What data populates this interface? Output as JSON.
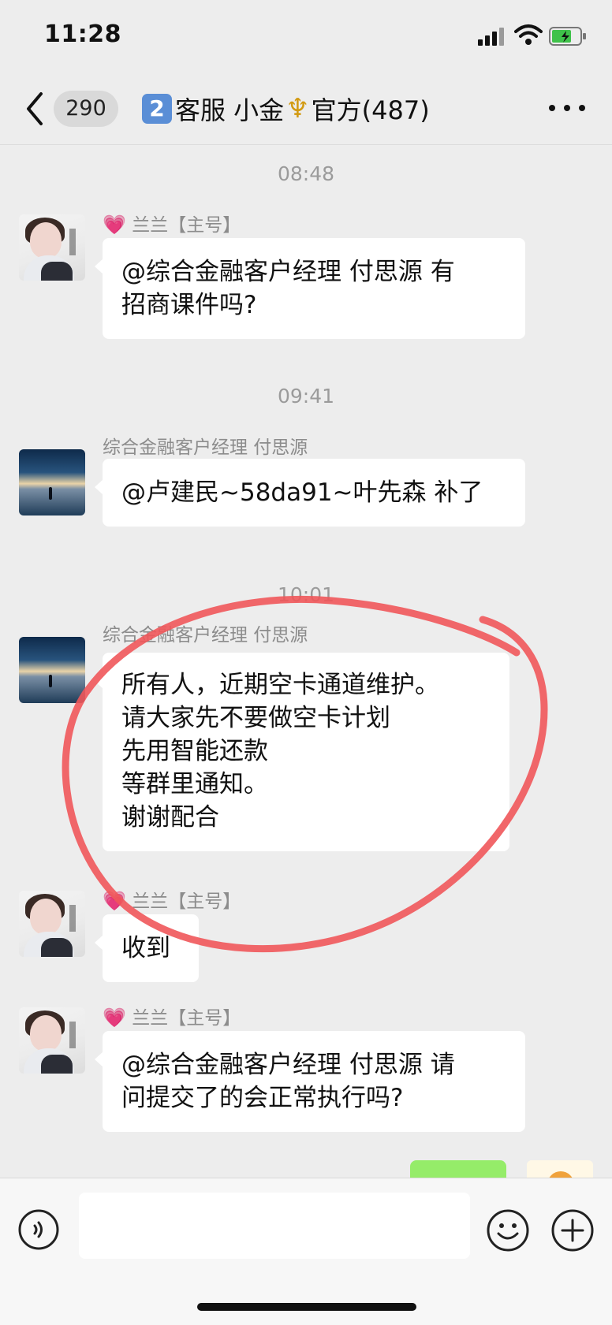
{
  "status_bar": {
    "time": "11:28"
  },
  "header": {
    "unread_count": "290",
    "group_number": "2",
    "title_prefix": "客服 小金",
    "title_suffix": "官方(487)"
  },
  "messages": [
    {
      "type": "time",
      "text": "08:48"
    },
    {
      "type": "text",
      "sender": "兰兰【主号】",
      "lines": [
        "@综合金融客户经理  付思源 有",
        "招商课件吗?"
      ]
    },
    {
      "type": "time",
      "text": "09:41"
    },
    {
      "type": "text",
      "sender": "综合金融客户经理  付思源",
      "lines": [
        "@卢建民~58da91~叶先森 补了"
      ]
    },
    {
      "type": "time",
      "text": "10:01"
    },
    {
      "type": "text",
      "sender": "综合金融客户经理  付思源",
      "lines": [
        "所有人，近期空卡通道维护。",
        "请大家先不要做空卡计划",
        "先用智能还款",
        "等群里通知。",
        "谢谢配合"
      ]
    },
    {
      "type": "text",
      "sender": "兰兰【主号】",
      "lines": [
        "收到"
      ]
    },
    {
      "type": "text",
      "sender": "兰兰【主号】",
      "lines": [
        "@综合金融客户经理  付思源 请",
        "问提交了的会正常执行吗?"
      ]
    }
  ],
  "icons": {
    "back": "chevron-left-icon",
    "more": "more-dots-icon",
    "voice": "voice-icon",
    "emoji": "emoji-icon",
    "plus": "plus-icon",
    "heart": "heart-icon",
    "trident": "trident-icon"
  },
  "colors": {
    "background": "#ededed",
    "bubble": "#ffffff",
    "my_bubble": "#95ec69",
    "annotation_circle": "#f0565a",
    "group_badge": "#5a8ed6"
  }
}
